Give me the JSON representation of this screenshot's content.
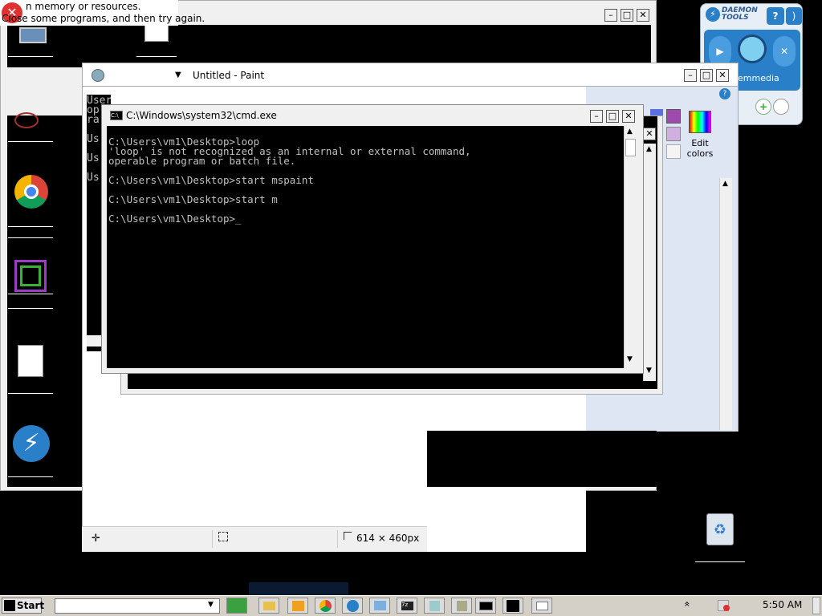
{
  "error_popup": {
    "line1": "n memory or resources.",
    "line2": "Close some programs, and then try again."
  },
  "paint": {
    "title": "Untitled - Paint",
    "edit_colors": "Edit colors",
    "status_size": "614 × 460px",
    "help": "?"
  },
  "cmd_behind_lines": [
    "Users\\vm1\\Desktop>loop",
    "op",
    "ra",
    "Us",
    "Us",
    "Us"
  ],
  "cmd": {
    "title": "C:\\Windows\\system32\\cmd.exe",
    "lines": [
      "C:\\Users\\vm1\\Desktop>loop",
      "'loop' is not recognized as an internal or external command,",
      "operable program or batch file.",
      "",
      "C:\\Users\\vm1\\Desktop>start mspaint",
      "",
      "C:\\Users\\vm1\\Desktop>start m",
      "",
      "C:\\Users\\vm1\\Desktop>_"
    ]
  },
  "daemon": {
    "logo": "DAEMON TOOLS",
    "media_label": "emmedia",
    "help": "?"
  },
  "taskbar": {
    "start_label": "Start",
    "time": "5:50 AM",
    "chevron": "»"
  },
  "colors": {
    "cmd_bg": "#000000",
    "window_chrome": "#f0f0f0",
    "daemon_blue": "#2a7fc9",
    "taskbar": "#d4d0c8",
    "error_red": "#e03030"
  }
}
